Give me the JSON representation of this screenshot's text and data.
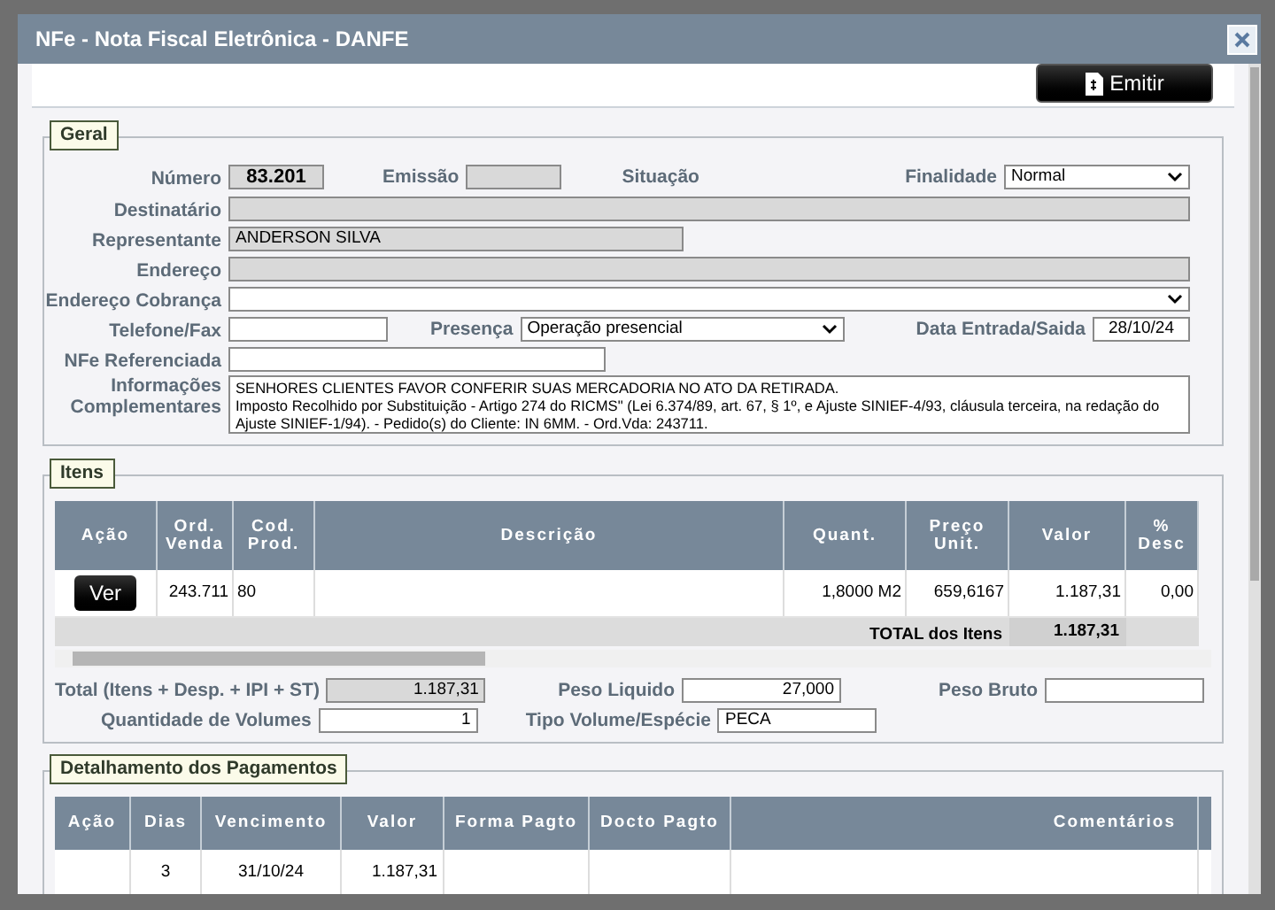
{
  "window": {
    "title": "NFe - Nota Fiscal Eletrônica - DANFE"
  },
  "toolbar": {
    "emit_button": "Emitir"
  },
  "geral": {
    "legend": "Geral",
    "numero": {
      "label": "Número",
      "value": "83.201"
    },
    "emissao": {
      "label": "Emissão"
    },
    "situacao": {
      "label": "Situação"
    },
    "finalidade": {
      "label": "Finalidade",
      "value": "Normal"
    },
    "destinatario": {
      "label": "Destinatário"
    },
    "representante": {
      "label": "Representante",
      "value": "ANDERSON SILVA"
    },
    "endereco": {
      "label": "Endereço"
    },
    "endereco_cobranca": {
      "label": "Endereço Cobrança"
    },
    "telefone": {
      "label": "Telefone/Fax"
    },
    "presenca": {
      "label": "Presença",
      "value": "Operação presencial"
    },
    "data_entrada": {
      "label": "Data Entrada/Saida",
      "value": "28/10/24"
    },
    "nfe_referenciada": {
      "label": "NFe Referenciada"
    },
    "informacoes": {
      "label": "Informações Complementares",
      "value": "SENHORES CLIENTES FAVOR CONFERIR SUAS MERCADORIA NO ATO DA RETIRADA.\nImposto Recolhido por Substituição - Artigo 274 do RICMS\" (Lei 6.374/89, art. 67, § 1º, e Ajuste SINIEF-4/93, cláusula terceira, na redação do Ajuste SINIEF-1/94). - Pedido(s) do Cliente: IN 6MM. - Ord.Vda: 243711."
    }
  },
  "itens": {
    "legend": "Itens",
    "columns": [
      "Ação",
      "Ord. Venda",
      "Cod. Prod.",
      "Descrição",
      "Quant.",
      "Preço Unit.",
      "Valor",
      "% Desc"
    ],
    "rows": [
      {
        "cells": [
          "Ver",
          "243.711",
          "80",
          "",
          "1,8000 M2",
          "659,6167",
          "1.187,31",
          "0,00"
        ]
      }
    ],
    "total_label": "TOTAL dos Itens",
    "total_value": "1.187,31",
    "total_geral": {
      "label": "Total (Itens + Desp. + IPI + ST)",
      "value": "1.187,31"
    },
    "peso_liquido": {
      "label": "Peso Liquido",
      "value": "27,000"
    },
    "peso_bruto": {
      "label": "Peso Bruto"
    },
    "volumes": {
      "label": "Quantidade de Volumes",
      "value": "1"
    },
    "tipo_volume": {
      "label": "Tipo Volume/Espécie",
      "value": "PECA"
    }
  },
  "pagamentos": {
    "legend": "Detalhamento dos Pagamentos",
    "columns": [
      "Ação",
      "Dias",
      "Vencimento",
      "Valor",
      "Forma Pagto",
      "Docto Pagto",
      "Comentários"
    ],
    "rows": [
      {
        "cells": [
          "",
          "3",
          "31/10/24",
          "1.187,31",
          "",
          "",
          ""
        ]
      }
    ]
  }
}
